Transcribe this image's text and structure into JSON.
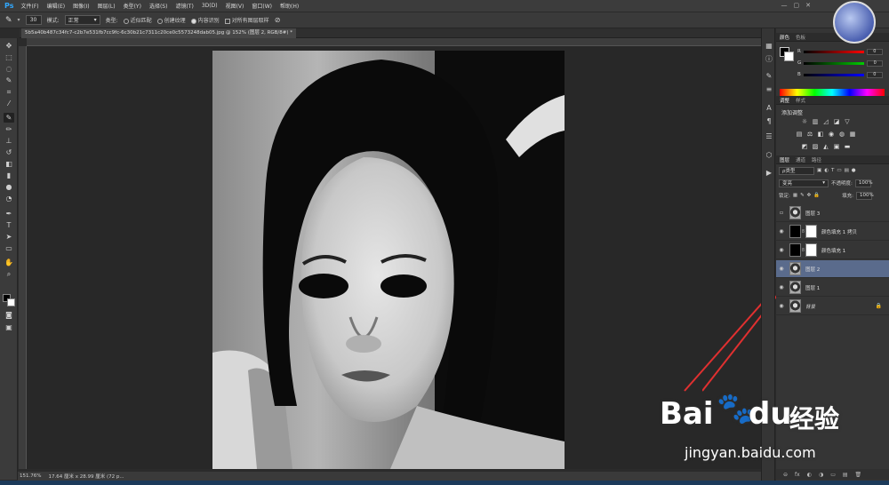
{
  "app": {
    "logo": "Ps"
  },
  "menu": [
    "文件(F)",
    "编辑(E)",
    "图像(I)",
    "图层(L)",
    "类型(Y)",
    "选择(S)",
    "滤镜(T)",
    "3D(D)",
    "视图(V)",
    "窗口(W)",
    "帮助(H)"
  ],
  "window_controls": [
    "—",
    "▢",
    "✕"
  ],
  "options": {
    "brush_size": "30",
    "mode_label": "模式:",
    "mode_value": "正常",
    "type_label": "类型:",
    "opt1": "近似匹配",
    "opt2": "创建纹理",
    "opt3": "内容识别",
    "sample_all": "对所有图层取样"
  },
  "document": {
    "tab_title": "5b5a40b487c34fc7-c2b7e531fb7cc9fc-6c30b21c7311c20ce0c5573248dab05.jpg @ 152% (图层 2, RGB/8#) *"
  },
  "status": {
    "zoom": "151.76%",
    "size": "17.64 厘米 x 28.99 厘米 (72 p..."
  },
  "color_panel": {
    "tabs": [
      "颜色",
      "色板"
    ],
    "channels": [
      {
        "label": "R",
        "value": "0",
        "color": "#d03030"
      },
      {
        "label": "G",
        "value": "0",
        "color": "#30b030"
      },
      {
        "label": "B",
        "value": "0",
        "color": "#3050d0"
      }
    ]
  },
  "adjustments_panel": {
    "tabs": [
      "调整",
      "样式"
    ],
    "title": "添加调整"
  },
  "layers_panel": {
    "tabs": [
      "图层",
      "通道",
      "路径"
    ],
    "kind_label": "ρ类型",
    "blend_mode": "变亮",
    "opacity_label": "不透明度:",
    "opacity_value": "100%",
    "lock_label": "锁定:",
    "fill_label": "填充:",
    "fill_value": "100%",
    "layers": [
      {
        "name": "图层 3",
        "visible": false,
        "thumb": "face",
        "mask": false,
        "selected": false
      },
      {
        "name": "颜色填充 1 拷贝",
        "visible": true,
        "thumb": "black",
        "mask": true,
        "selected": false
      },
      {
        "name": "颜色填充 1",
        "visible": true,
        "thumb": "black",
        "mask": true,
        "selected": false
      },
      {
        "name": "图层 2",
        "visible": true,
        "thumb": "face",
        "mask": false,
        "selected": true
      },
      {
        "name": "图层 1",
        "visible": true,
        "thumb": "face",
        "mask": false,
        "selected": false
      },
      {
        "name": "背景",
        "visible": true,
        "thumb": "face",
        "mask": false,
        "selected": false,
        "locked": true
      }
    ],
    "bottom_icons": [
      "⊖",
      "fx",
      "◐",
      "◑",
      "▭",
      "▤",
      "🗑"
    ]
  },
  "watermark": {
    "brand": "Bai",
    "brand2": "du",
    "brand_cn": "经验",
    "url": "jingyan.baidu.com"
  },
  "colors": {
    "accent": "#31a8ff",
    "selected_layer": "#5a6b8c",
    "arrow": "#e03030"
  }
}
